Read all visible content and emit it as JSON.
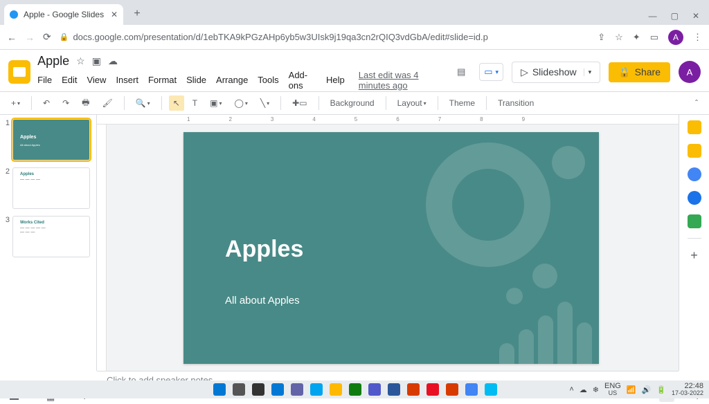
{
  "browser": {
    "tab_title": "Apple - Google Slides",
    "url": "docs.google.com/presentation/d/1ebTKA9kPGzAHp6yb5w3UIsk9j19qa3cn2rQIQ3vdGbA/edit#slide=id.p",
    "avatar_letter": "A"
  },
  "doc": {
    "title": "Apple",
    "menus": [
      "File",
      "Edit",
      "View",
      "Insert",
      "Format",
      "Slide",
      "Arrange",
      "Tools",
      "Add-ons",
      "Help"
    ],
    "last_edit": "Last edit was 4 minutes ago",
    "slideshow_label": "Slideshow",
    "share_label": "Share"
  },
  "toolbar": {
    "background": "Background",
    "layout": "Layout",
    "theme": "Theme",
    "transition": "Transition"
  },
  "ruler_ticks": "123456789",
  "slides": [
    {
      "title": "Apples",
      "subtitle": "All about Apples"
    },
    {
      "heading": "Apples"
    },
    {
      "heading": "Works Cited"
    }
  ],
  "current_slide": {
    "title": "Apples",
    "subtitle": "All about Apples"
  },
  "notes_placeholder": "Click to add speaker notes",
  "system": {
    "lang1": "ENG",
    "lang2": "US",
    "time": "22:48",
    "date": "17-03-2022"
  }
}
